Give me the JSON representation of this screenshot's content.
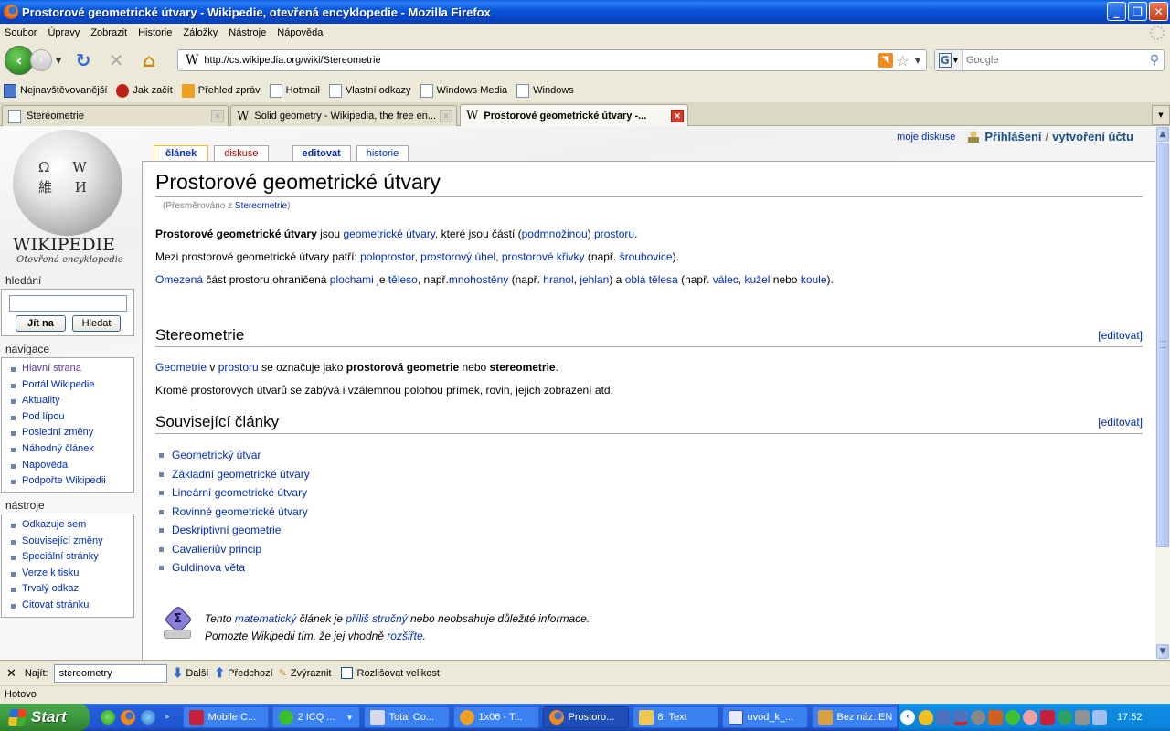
{
  "window": {
    "title": "Prostorové geometrické útvary - Wikipedie, otevřená encyklopedie - Mozilla Firefox",
    "minimize": "_",
    "restore": "❐",
    "close": "✕"
  },
  "menu": [
    "Soubor",
    "Úpravy",
    "Zobrazit",
    "Historie",
    "Záložky",
    "Nástroje",
    "Nápověda"
  ],
  "navbar": {
    "back": "‹",
    "forward": "›",
    "reload": "↻",
    "stop": "✕",
    "home": "⌂",
    "url_favicon": "W",
    "url": "http://cs.wikipedia.org/wiki/Stereometrie",
    "search_placeholder": "Google",
    "search_engine": "G"
  },
  "bookmarks": [
    {
      "label": "Nejnavštěvovanější",
      "icon": "most-visited-icon"
    },
    {
      "label": "Jak začít",
      "icon": "getting-started-icon"
    },
    {
      "label": "Přehled zpráv",
      "icon": "rss-feed-icon"
    },
    {
      "label": "Hotmail",
      "icon": "page-icon"
    },
    {
      "label": "Vlastní odkazy",
      "icon": "page-icon"
    },
    {
      "label": "Windows Media",
      "icon": "page-icon"
    },
    {
      "label": "Windows",
      "icon": "page-icon"
    }
  ],
  "tabs": [
    {
      "label": "Stereometrie",
      "favicon": "",
      "active": false
    },
    {
      "label": "Solid geometry - Wikipedia, the free en...",
      "favicon": "W",
      "active": false
    },
    {
      "label": "Prostorové geometrické útvary -...",
      "favicon": "W",
      "active": true
    }
  ],
  "wiki": {
    "logo_word": "WIKIPEDIE",
    "logo_sub": "Otevřená encyklopedie",
    "globe_glyphs": "Ω W 維 И",
    "search_heading": "hledání",
    "go_button": "Jít na",
    "search_button": "Hledat",
    "nav_heading": "navigace",
    "nav_items": [
      "Hlavní strana",
      "Portál Wikipedie",
      "Aktuality",
      "Pod lípou",
      "Poslední změny",
      "Náhodný článek",
      "Nápověda",
      "Podpořte Wikipedii"
    ],
    "tools_heading": "nástroje",
    "tools_items": [
      "Odkazuje sem",
      "Související změny",
      "Speciální stránky",
      "Verze k tisku",
      "Trvalý odkaz",
      "Citovat stránku"
    ],
    "page_tabs": [
      "článek",
      "diskuse",
      "editovat",
      "historie"
    ],
    "personal_talk": "moje diskuse",
    "login": "Přihlášení",
    "login_sep": "/",
    "create_account": "vytvoření účtu",
    "title": "Prostorové geometrické útvary",
    "redirect_prefix": "(Přesměrováno z ",
    "redirect_link": "Stereometrie",
    "redirect_suffix": ")",
    "p1": {
      "bold": "Prostorové geometrické útvary",
      "t1": " jsou ",
      "l1": "geometrické útvary",
      "t2": ", které jsou částí (",
      "l2": "podmnožinou",
      "t3": ") ",
      "l3": "prostoru",
      "t4": "."
    },
    "p2": {
      "t1": "Mezi prostorové geometrické útvary patří: ",
      "l1": "poloprostor",
      "t2": ", ",
      "l2": "prostorový úhel",
      "t3": ", ",
      "l3": "prostorové křivky",
      "t4": " (např. ",
      "l4": "šroubovice",
      "t5": ")."
    },
    "p3": {
      "l1": "Omezená",
      "t1": " část prostoru ohraničená ",
      "l2": "plochami",
      "t2": " je ",
      "l3": "těleso",
      "t3": ", např.",
      "l4": "mnohostěny",
      "t4": " (např. ",
      "l5": "hranol",
      "t5": ", ",
      "l6": "jehlan",
      "t6": ") a ",
      "l7": "oblá tělesa",
      "t7": " (např. ",
      "l8": "válec",
      "t8": ", ",
      "l9": "kužel",
      "t9": " nebo ",
      "l10": "koule",
      "t10": ")."
    },
    "h2_stereo": "Stereometrie",
    "edit_label": "[editovat]",
    "p4": {
      "l1": "Geometrie",
      "t1": " v ",
      "l2": "prostoru",
      "t2": " se označuje jako ",
      "b1": "prostorová geometrie",
      "t3": " nebo ",
      "b2": "stereometrie",
      "t4": "."
    },
    "p5": "Kromě prostorových útvarů se zabývá i vzálemnou polohou přímek, rovin, jejich zobrazení atd.",
    "h2_related": "Související články",
    "related": [
      "Geometrický útvar",
      "Základní geometrické útvary",
      "Lineární geometrické útvary",
      "Rovinné geometrické útvary",
      "Deskriptivní geometrie",
      "Cavalieriův princip",
      "Guldinova věta"
    ],
    "stub": {
      "t1": "Tento ",
      "l1": "matematický",
      "t2": " článek je ",
      "l2": "příliš stručný",
      "t3": " nebo neobsahuje důležité informace.",
      "t4": "Pomozte Wikipedii tím, že jej vhodně ",
      "l3": "rozšiřte",
      "t5": "."
    }
  },
  "findbar": {
    "close": "✕",
    "label": "Najít:",
    "value": "stereometry",
    "next": "Další",
    "previous": "Předchozí",
    "highlight": "Zvýraznit",
    "match_case": "Rozlišovat velikost",
    "match_case_checked": false
  },
  "status": "Hotovo",
  "taskbar": {
    "start": "Start",
    "quick_more": "»",
    "tasks": [
      {
        "label": "Mobile C...",
        "color": "#c8203a",
        "active": false
      },
      {
        "label": "2 ICQ ...",
        "color": "#3cbf2c",
        "active": false,
        "group": true
      },
      {
        "label": "Total Co...",
        "color": "#d8d8f0",
        "active": false
      },
      {
        "label": "1x06 - T...",
        "color": "#f0a020",
        "active": false
      },
      {
        "label": "Prostoro...",
        "color": "#e2701a",
        "active": true
      },
      {
        "label": "8. Text",
        "color": "#f0c850",
        "active": false
      },
      {
        "label": "uvod_k_...",
        "color": "#e8e8f8",
        "active": false
      },
      {
        "label": "Bez náz...",
        "color": "#d8a040",
        "active": false
      }
    ],
    "lang": "EN",
    "clock": "17:52",
    "tray_chevron": "‹"
  }
}
